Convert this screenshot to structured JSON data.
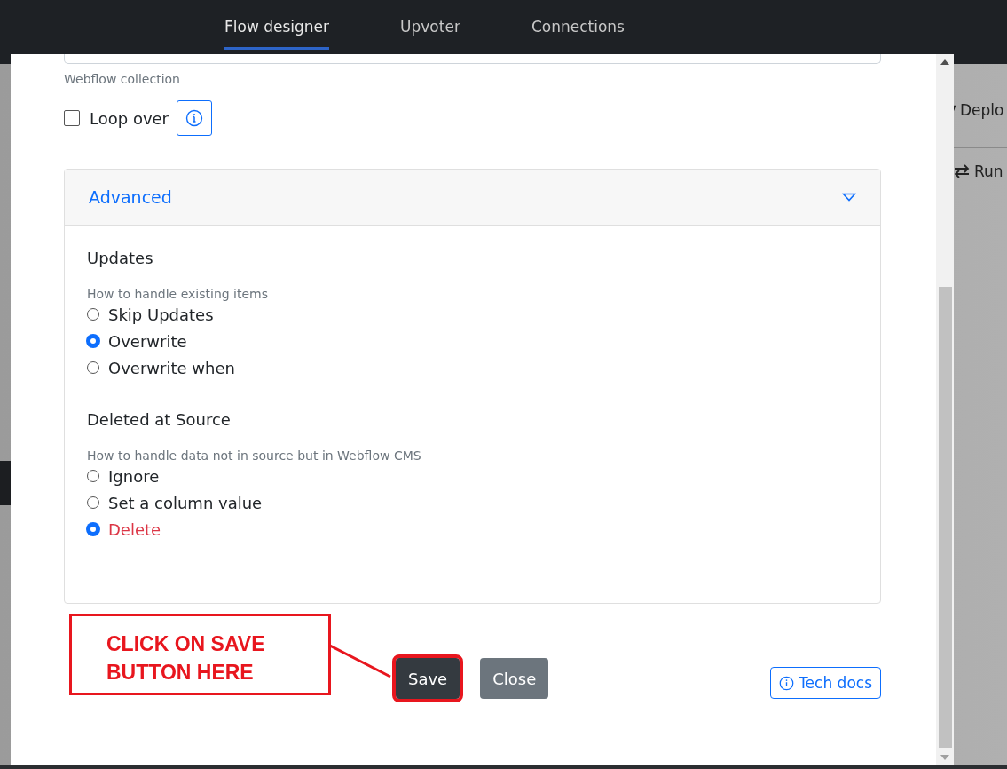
{
  "nav": {
    "tabs": [
      {
        "label": "Flow designer",
        "selected": true
      },
      {
        "label": "Upvoter",
        "selected": false
      },
      {
        "label": "Connections",
        "selected": false
      }
    ]
  },
  "background": {
    "deploy_fragment": "Deplo",
    "run_fragment": "Run"
  },
  "modal": {
    "field_caption": "Webflow collection",
    "loop_over": {
      "label": "Loop over",
      "checked": false
    },
    "advanced": {
      "title": "Advanced",
      "expanded": true,
      "sections": [
        {
          "title": "Updates",
          "hint": "How to handle existing items",
          "options": [
            {
              "label": "Skip Updates",
              "selected": false,
              "kind": "normal"
            },
            {
              "label": "Overwrite",
              "selected": true,
              "kind": "normal"
            },
            {
              "label": "Overwrite when",
              "selected": false,
              "kind": "normal"
            }
          ]
        },
        {
          "title": "Deleted at Source",
          "hint": "How to handle data not in source but in Webflow CMS",
          "options": [
            {
              "label": "Ignore",
              "selected": false,
              "kind": "normal"
            },
            {
              "label": "Set a column value",
              "selected": false,
              "kind": "normal"
            },
            {
              "label": "Delete",
              "selected": true,
              "kind": "danger"
            }
          ]
        }
      ]
    },
    "buttons": [
      {
        "label": "Save",
        "kind": "primary"
      },
      {
        "label": "Close",
        "kind": "secondary"
      }
    ],
    "tech_docs": "Tech docs"
  },
  "annotation": {
    "lines": [
      "CLICK ON SAVE",
      "BUTTON HERE"
    ]
  }
}
